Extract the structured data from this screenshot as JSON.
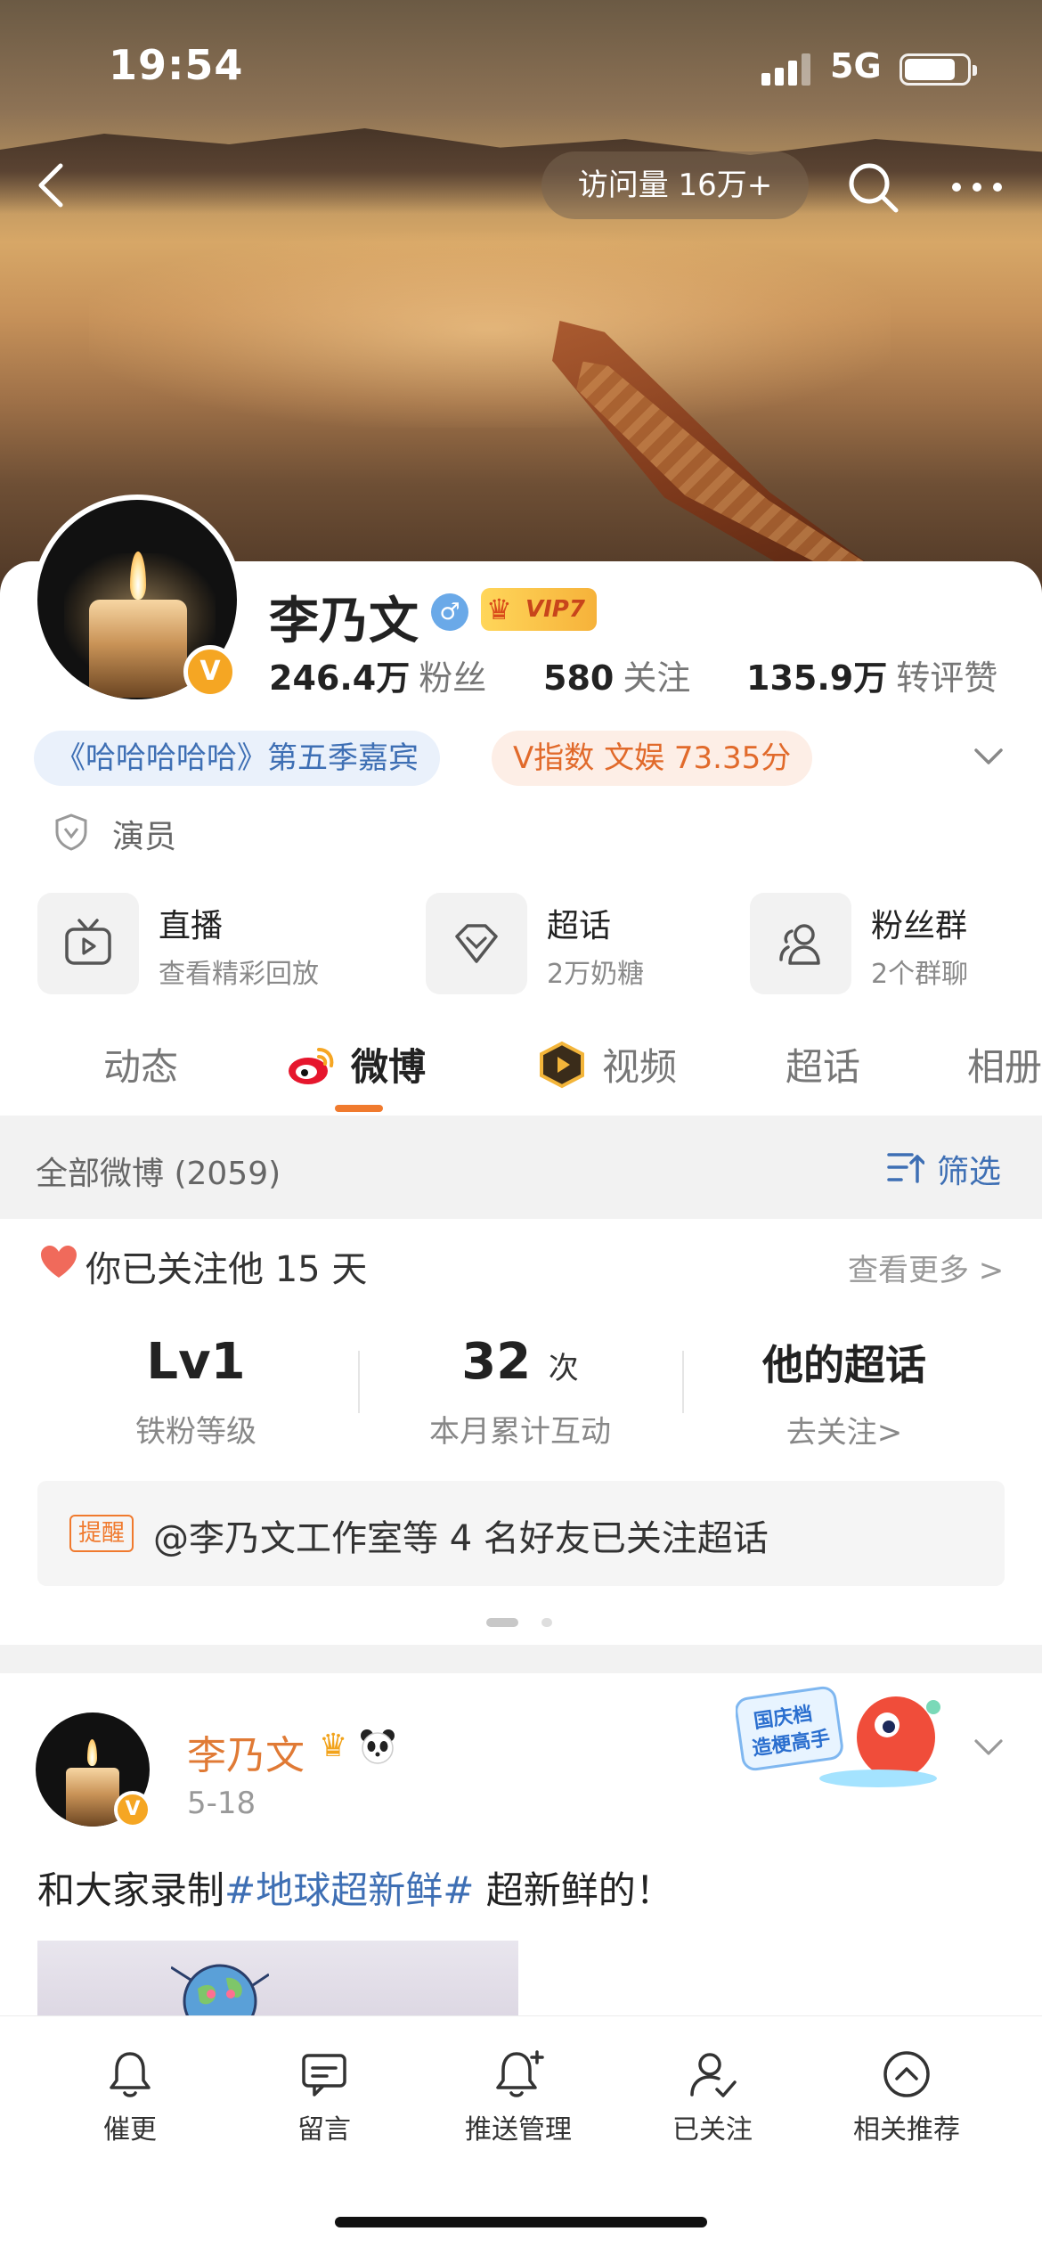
{
  "status_bar": {
    "time": "19:54",
    "network": "5G"
  },
  "nav": {
    "visits": "访问量 16万+"
  },
  "profile": {
    "name": "李乃文",
    "vip_level": "VIP7",
    "verified_badge": "V",
    "stats": [
      {
        "num": "246.4万",
        "label": "粉丝"
      },
      {
        "num": "580",
        "label": "关注"
      },
      {
        "num": "135.9万",
        "label": "转评赞"
      }
    ],
    "tags": {
      "show": "《哈哈哈哈哈》第五季嘉宾",
      "vindex": "V指数 文娱 73.35分"
    },
    "role": "演员"
  },
  "features": [
    {
      "title": "直播",
      "sub": "查看精彩回放",
      "icon": "tv-icon"
    },
    {
      "title": "超话",
      "sub": "2万奶糖",
      "icon": "diamond-icon"
    },
    {
      "title": "粉丝群",
      "sub": "2个群聊",
      "icon": "group-icon"
    }
  ],
  "tabs": [
    "动态",
    "微博",
    "视频",
    "超话",
    "相册"
  ],
  "feed": {
    "count_label": "全部微博 (2059)",
    "filter_label": "筛选"
  },
  "fan_card": {
    "follow_days": "你已关注他 15 天",
    "see_more": "查看更多 >",
    "stats": [
      {
        "big": "Lv1",
        "unit": "",
        "cap": "铁粉等级"
      },
      {
        "big": "32",
        "unit": "次",
        "cap": "本月累计互动"
      },
      {
        "big": "他的超话",
        "unit": "",
        "cap": "去关注>"
      }
    ],
    "remind_tag": "提醒",
    "remind_text": "@李乃文工作室等 4 名好友已关注超话"
  },
  "post": {
    "author": "李乃文",
    "date": "5-18",
    "text_before": "和大家录制",
    "topic": "#地球超新鲜#",
    "text_after": " 超新鲜的！",
    "sticker_text": "国庆档 造梗高手"
  },
  "bottom_bar": [
    {
      "label": "催更",
      "icon": "bell-icon"
    },
    {
      "label": "留言",
      "icon": "message-icon"
    },
    {
      "label": "推送管理",
      "icon": "bell-plus-icon"
    },
    {
      "label": "已关注",
      "icon": "user-check-icon"
    },
    {
      "label": "相关推荐",
      "icon": "chevron-up-circle-icon"
    }
  ],
  "colors": {
    "accent": "#f07a2e",
    "link": "#3e6fb4",
    "vip_gold": "#f5a623"
  }
}
